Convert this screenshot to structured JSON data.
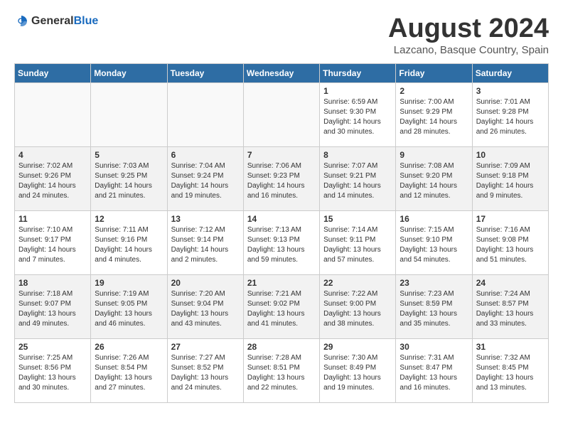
{
  "header": {
    "logo_general": "General",
    "logo_blue": "Blue",
    "month_year": "August 2024",
    "location": "Lazcano, Basque Country, Spain"
  },
  "days_of_week": [
    "Sunday",
    "Monday",
    "Tuesday",
    "Wednesday",
    "Thursday",
    "Friday",
    "Saturday"
  ],
  "weeks": [
    [
      {
        "day": "",
        "info": ""
      },
      {
        "day": "",
        "info": ""
      },
      {
        "day": "",
        "info": ""
      },
      {
        "day": "",
        "info": ""
      },
      {
        "day": "1",
        "info": "Sunrise: 6:59 AM\nSunset: 9:30 PM\nDaylight: 14 hours\nand 30 minutes."
      },
      {
        "day": "2",
        "info": "Sunrise: 7:00 AM\nSunset: 9:29 PM\nDaylight: 14 hours\nand 28 minutes."
      },
      {
        "day": "3",
        "info": "Sunrise: 7:01 AM\nSunset: 9:28 PM\nDaylight: 14 hours\nand 26 minutes."
      }
    ],
    [
      {
        "day": "4",
        "info": "Sunrise: 7:02 AM\nSunset: 9:26 PM\nDaylight: 14 hours\nand 24 minutes."
      },
      {
        "day": "5",
        "info": "Sunrise: 7:03 AM\nSunset: 9:25 PM\nDaylight: 14 hours\nand 21 minutes."
      },
      {
        "day": "6",
        "info": "Sunrise: 7:04 AM\nSunset: 9:24 PM\nDaylight: 14 hours\nand 19 minutes."
      },
      {
        "day": "7",
        "info": "Sunrise: 7:06 AM\nSunset: 9:23 PM\nDaylight: 14 hours\nand 16 minutes."
      },
      {
        "day": "8",
        "info": "Sunrise: 7:07 AM\nSunset: 9:21 PM\nDaylight: 14 hours\nand 14 minutes."
      },
      {
        "day": "9",
        "info": "Sunrise: 7:08 AM\nSunset: 9:20 PM\nDaylight: 14 hours\nand 12 minutes."
      },
      {
        "day": "10",
        "info": "Sunrise: 7:09 AM\nSunset: 9:18 PM\nDaylight: 14 hours\nand 9 minutes."
      }
    ],
    [
      {
        "day": "11",
        "info": "Sunrise: 7:10 AM\nSunset: 9:17 PM\nDaylight: 14 hours\nand 7 minutes."
      },
      {
        "day": "12",
        "info": "Sunrise: 7:11 AM\nSunset: 9:16 PM\nDaylight: 14 hours\nand 4 minutes."
      },
      {
        "day": "13",
        "info": "Sunrise: 7:12 AM\nSunset: 9:14 PM\nDaylight: 14 hours\nand 2 minutes."
      },
      {
        "day": "14",
        "info": "Sunrise: 7:13 AM\nSunset: 9:13 PM\nDaylight: 13 hours\nand 59 minutes."
      },
      {
        "day": "15",
        "info": "Sunrise: 7:14 AM\nSunset: 9:11 PM\nDaylight: 13 hours\nand 57 minutes."
      },
      {
        "day": "16",
        "info": "Sunrise: 7:15 AM\nSunset: 9:10 PM\nDaylight: 13 hours\nand 54 minutes."
      },
      {
        "day": "17",
        "info": "Sunrise: 7:16 AM\nSunset: 9:08 PM\nDaylight: 13 hours\nand 51 minutes."
      }
    ],
    [
      {
        "day": "18",
        "info": "Sunrise: 7:18 AM\nSunset: 9:07 PM\nDaylight: 13 hours\nand 49 minutes."
      },
      {
        "day": "19",
        "info": "Sunrise: 7:19 AM\nSunset: 9:05 PM\nDaylight: 13 hours\nand 46 minutes."
      },
      {
        "day": "20",
        "info": "Sunrise: 7:20 AM\nSunset: 9:04 PM\nDaylight: 13 hours\nand 43 minutes."
      },
      {
        "day": "21",
        "info": "Sunrise: 7:21 AM\nSunset: 9:02 PM\nDaylight: 13 hours\nand 41 minutes."
      },
      {
        "day": "22",
        "info": "Sunrise: 7:22 AM\nSunset: 9:00 PM\nDaylight: 13 hours\nand 38 minutes."
      },
      {
        "day": "23",
        "info": "Sunrise: 7:23 AM\nSunset: 8:59 PM\nDaylight: 13 hours\nand 35 minutes."
      },
      {
        "day": "24",
        "info": "Sunrise: 7:24 AM\nSunset: 8:57 PM\nDaylight: 13 hours\nand 33 minutes."
      }
    ],
    [
      {
        "day": "25",
        "info": "Sunrise: 7:25 AM\nSunset: 8:56 PM\nDaylight: 13 hours\nand 30 minutes."
      },
      {
        "day": "26",
        "info": "Sunrise: 7:26 AM\nSunset: 8:54 PM\nDaylight: 13 hours\nand 27 minutes."
      },
      {
        "day": "27",
        "info": "Sunrise: 7:27 AM\nSunset: 8:52 PM\nDaylight: 13 hours\nand 24 minutes."
      },
      {
        "day": "28",
        "info": "Sunrise: 7:28 AM\nSunset: 8:51 PM\nDaylight: 13 hours\nand 22 minutes."
      },
      {
        "day": "29",
        "info": "Sunrise: 7:30 AM\nSunset: 8:49 PM\nDaylight: 13 hours\nand 19 minutes."
      },
      {
        "day": "30",
        "info": "Sunrise: 7:31 AM\nSunset: 8:47 PM\nDaylight: 13 hours\nand 16 minutes."
      },
      {
        "day": "31",
        "info": "Sunrise: 7:32 AM\nSunset: 8:45 PM\nDaylight: 13 hours\nand 13 minutes."
      }
    ]
  ]
}
